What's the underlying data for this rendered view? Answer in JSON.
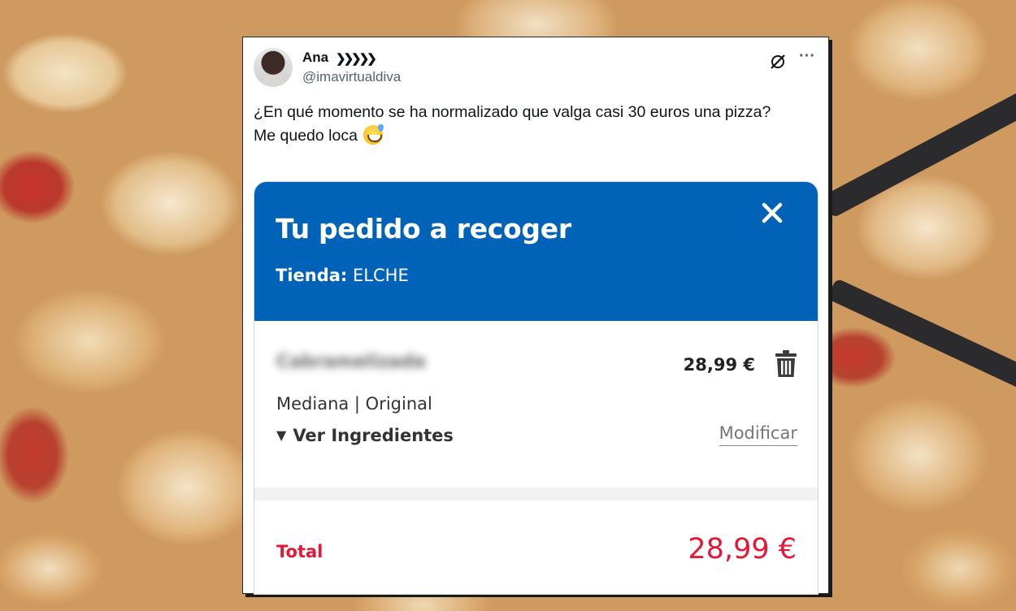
{
  "tweet": {
    "display_name": "Ana",
    "name_suffix": "❯❯❯❯❯",
    "handle": "@imavirtualdiva",
    "text_line1": "¿En qué momento se ha normalizado que valga casi 30 euros una pizza?",
    "text_line2": "Me quedo loca",
    "emoji": "grinning-face-with-sweat",
    "icons": [
      "grok-icon",
      "more-icon"
    ]
  },
  "order": {
    "title": "Tu pedido a recoger",
    "store_label": "Tienda:",
    "store_value": "ELCHE",
    "item": {
      "name": "Cabramelizada",
      "price": "28,99 €",
      "size": "Mediana | Original",
      "ingredients_toggle": "Ver Ingredientes",
      "modify_label": "Modificar"
    },
    "total_label": "Total",
    "total_value": "28,99 €",
    "colors": {
      "header_blue": "#0063b8",
      "total_red": "#e31837"
    }
  }
}
